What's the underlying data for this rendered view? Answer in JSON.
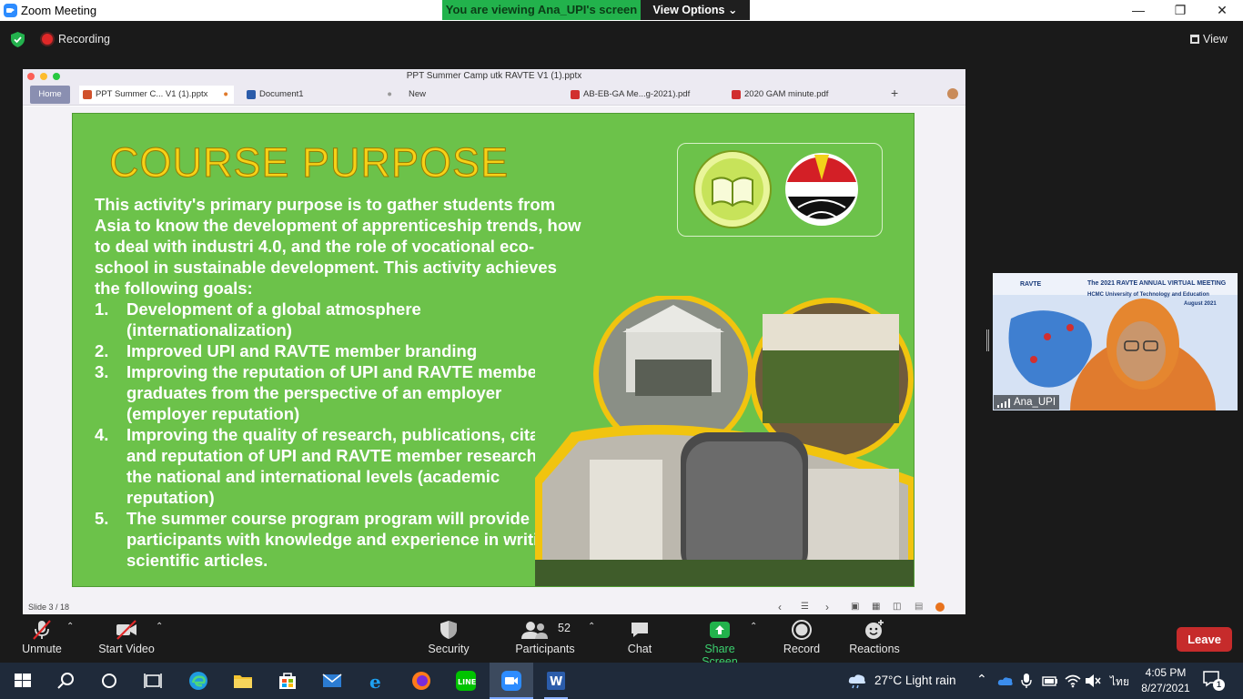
{
  "window": {
    "title": "Zoom Meeting",
    "viewing_banner": "You are viewing Ana_UPI's screen",
    "view_options": "View Options"
  },
  "top_strip": {
    "recording_label": "Recording",
    "view_label": "View"
  },
  "shared_app": {
    "window_title": "PPT Summer Camp utk RAVTE V1 (1).pptx",
    "tabs": [
      {
        "label": "Home"
      },
      {
        "label": "PPT Summer C... V1 (1).pptx"
      },
      {
        "label": "Document1"
      },
      {
        "label": "New"
      },
      {
        "label": "AB-EB-GA Me...g-2021).pdf"
      },
      {
        "label": "2020 GAM minute.pdf"
      }
    ],
    "status_slide": "Slide 3 / 18"
  },
  "slide": {
    "title": "COURSE PURPOSE",
    "intro": "This activity's primary purpose is to gather students from Asia to know the development of apprenticeship trends, how to deal with industri 4.0, and the role of vocational eco-school in sustainable development. This activity achieves the following goals:",
    "goals": [
      {
        "num": "1.",
        "text": "Development of a global atmosphere (internationalization)"
      },
      {
        "num": "2.",
        "text": "Improved UPI  and RAVTE member branding"
      },
      {
        "num": "3.",
        "text": "Improving the reputation of UPI and RAVTE member graduates from the perspective of an employer (employer reputation)"
      },
      {
        "num": "4.",
        "text": "Improving the quality of research, publications, citations, and reputation of UPI and RAVTE member researchers at the national and international levels (academic reputation)"
      },
      {
        "num": "5.",
        "text": "The summer course program program will provide participants with knowledge and experience in writing scientific articles."
      }
    ]
  },
  "participant_video": {
    "name": "Ana_UPI",
    "banner_line1": "The 2021 RAVTE ANNUAL VIRTUAL MEETING",
    "banner_line2": "HCMC University of Technology and Education",
    "banner_line3": "August 2021",
    "logo_text": "RAVTE"
  },
  "toolbar": {
    "unmute": "Unmute",
    "start_video": "Start Video",
    "security": "Security",
    "participants": "Participants",
    "participants_count": "52",
    "chat": "Chat",
    "share_screen": "Share Screen",
    "record": "Record",
    "reactions": "Reactions",
    "leave": "Leave"
  },
  "taskbar": {
    "weather": "27°C  Light rain",
    "language": "ไทย",
    "time": "4:05 PM",
    "date": "8/27/2021",
    "notifications": "1"
  },
  "colors": {
    "zoom_blue": "#2d8cff",
    "banner_green": "#22b24c",
    "share_green": "#22b24c",
    "slide_green": "#6cc24a",
    "title_yellow": "#f7d117",
    "leave_red": "#c62b2b"
  }
}
